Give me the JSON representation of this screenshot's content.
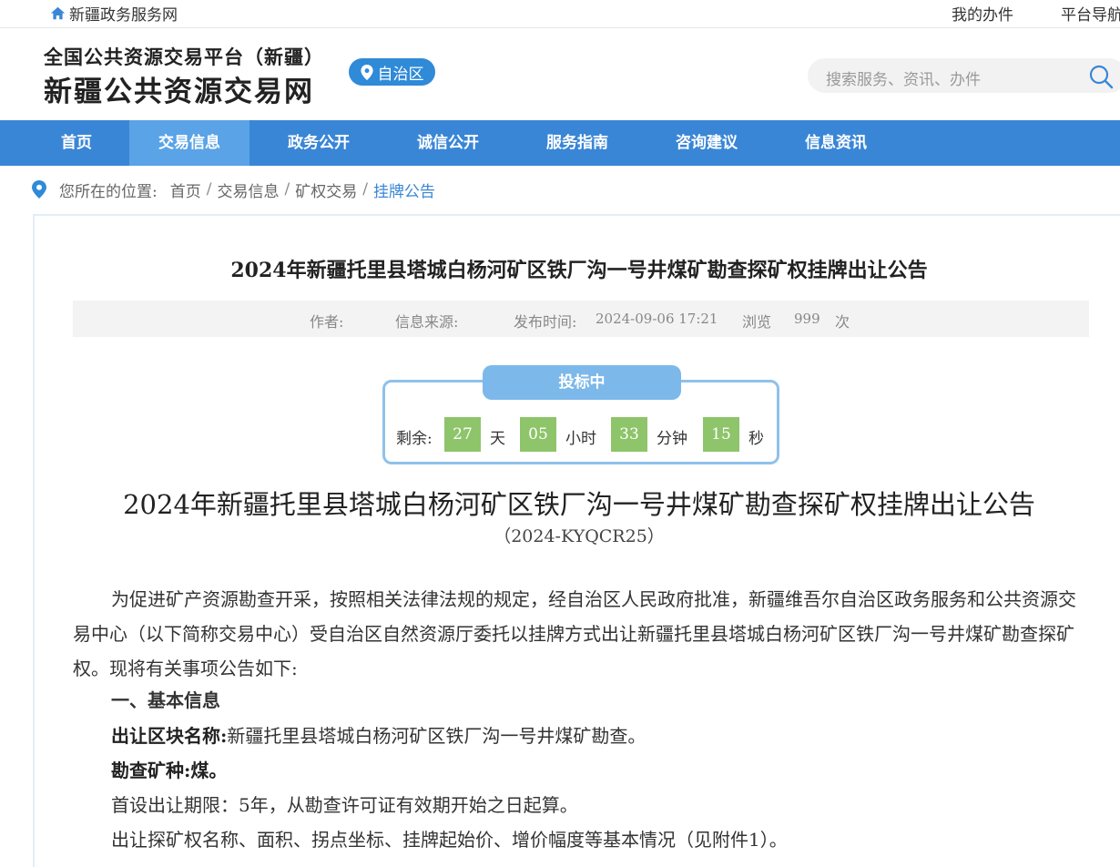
{
  "topbar": {
    "gov_site": "新疆政务服务网",
    "my_affairs": "我的办件",
    "platform_nav": "平台导航"
  },
  "header": {
    "logo_line1": "全国公共资源交易平台（新疆）",
    "logo_line2": "新疆公共资源交易网",
    "region_label": "自治区",
    "search_placeholder": "搜索服务、资讯、办件"
  },
  "nav": {
    "items": [
      {
        "label": "首页"
      },
      {
        "label": "交易信息"
      },
      {
        "label": "政务公开"
      },
      {
        "label": "诚信公开"
      },
      {
        "label": "服务指南"
      },
      {
        "label": "咨询建议"
      },
      {
        "label": "信息资讯"
      }
    ],
    "active": "交易信息"
  },
  "breadcrumb": {
    "prefix": "您所在的位置:",
    "items": [
      "首页",
      "交易信息",
      "矿权交易",
      "挂牌公告"
    ],
    "separator": "/"
  },
  "article": {
    "title": "2024年新疆托里县塔城白杨河矿区铁厂沟一号井煤矿勘查探矿权挂牌出让公告",
    "meta": {
      "author_label": "作者:",
      "source_label": "信息来源:",
      "publish_label": "发布时间:",
      "publish_time": "2024-09-06 17:21",
      "views_label": "浏览",
      "views": "999",
      "views_unit": "次"
    },
    "countdown": {
      "status": "投标中",
      "remaining_label": "剩余:",
      "days": "27",
      "days_unit": "天",
      "hours": "05",
      "hours_unit": "小时",
      "minutes": "33",
      "minutes_unit": "分钟",
      "seconds": "15",
      "seconds_unit": "秒"
    },
    "heading": "2024年新疆托里县塔城白杨河矿区铁厂沟一号井煤矿勘查探矿权挂牌出让公告",
    "doc_number": "（2024-KYQCR25）",
    "intro": "为促进矿产资源勘查开采，按照相关法律法规的规定，经自治区人民政府批准，新疆维吾尔自治区政务服务和公共资源交易中心（以下简称交易中心）受自治区自然资源厅委托以挂牌方式出让新疆托里县塔城白杨河矿区铁厂沟一号井煤矿勘查探矿权。现将有关事项公告如下:",
    "section1": "一、基本信息",
    "block_name_label": "出让区块名称:",
    "block_name": "新疆托里县塔城白杨河矿区铁厂沟一号井煤矿勘查。",
    "mineral_label": "勘查矿种:",
    "mineral": "煤。",
    "term": "首设出让期限：5年，从勘查许可证有效期开始之日起算。",
    "details": "出让探矿权名称、面积、拐点坐标、挂牌起始价、增价幅度等基本情况（见附件1）。"
  },
  "colors": {
    "nav_bg": "#3a86d6",
    "nav_active": "#5aa3e6",
    "countdown_box": "#8ec46a",
    "badge": "#7db8ea"
  }
}
